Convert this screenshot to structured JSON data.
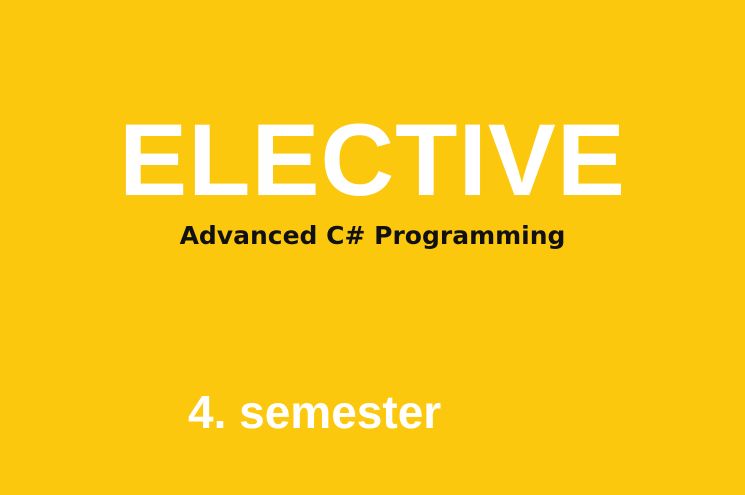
{
  "banner": {
    "title": "ELECTIVE",
    "subtitle": "Advanced C# Programming",
    "semester": "4. semester"
  },
  "colors": {
    "background": "#fcc80e",
    "title": "#ffffff",
    "subtitle": "#111111",
    "semester": "#ffffff"
  }
}
